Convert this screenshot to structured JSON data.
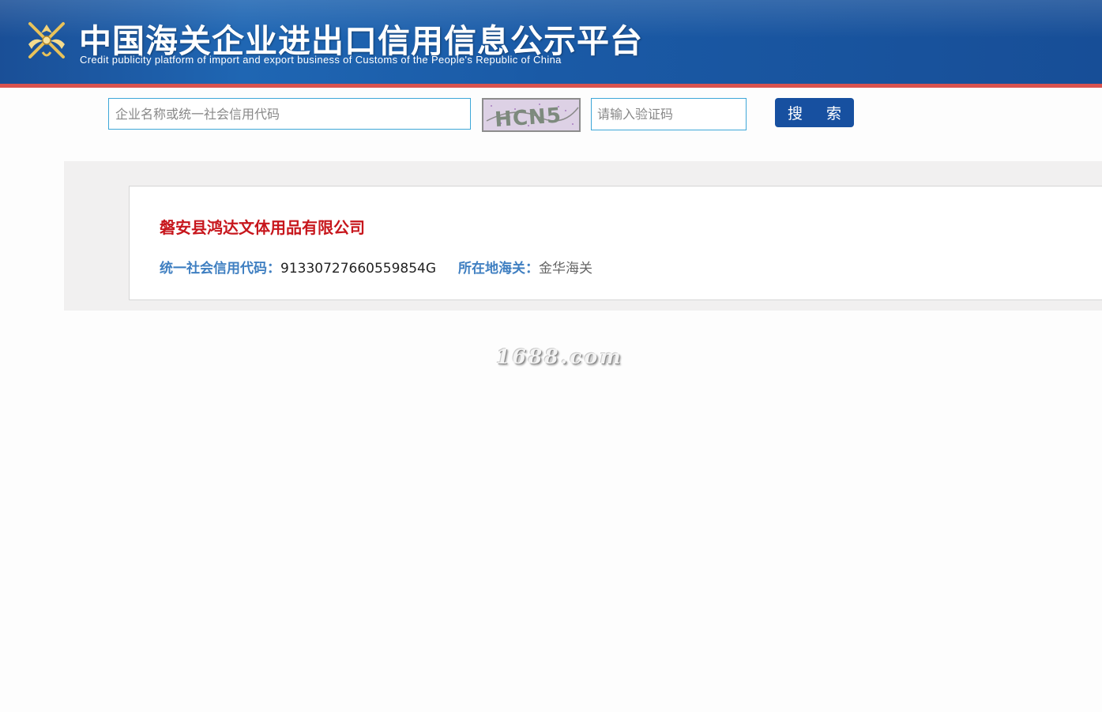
{
  "header": {
    "title_cn": "中国海关企业进出口信用信息公示平台",
    "title_en": "Credit publicity platform of import and export business of Customs of the People's Republic of China",
    "logo_icon": "customs-emblem-icon",
    "colors": {
      "banner": "#1a5aa6",
      "accent_line": "#d9534f"
    }
  },
  "search": {
    "company_placeholder": "企业名称或统一社会信用代码",
    "company_value": "",
    "captcha_text": "HCN5",
    "captcha_placeholder": "请输入验证码",
    "captcha_value": "",
    "button_label": "搜 索",
    "button_color": "#1750a0"
  },
  "result": {
    "company_name": "磐安县鸿达文体用品有限公司",
    "credit_code_label": "统一社会信用代码：",
    "credit_code_value": "91330727660559854G",
    "customs_label": "所在地海关：",
    "customs_value": "金华海关",
    "name_color": "#c7161c",
    "label_color": "#3f7fc1"
  },
  "watermark": "1688.com"
}
